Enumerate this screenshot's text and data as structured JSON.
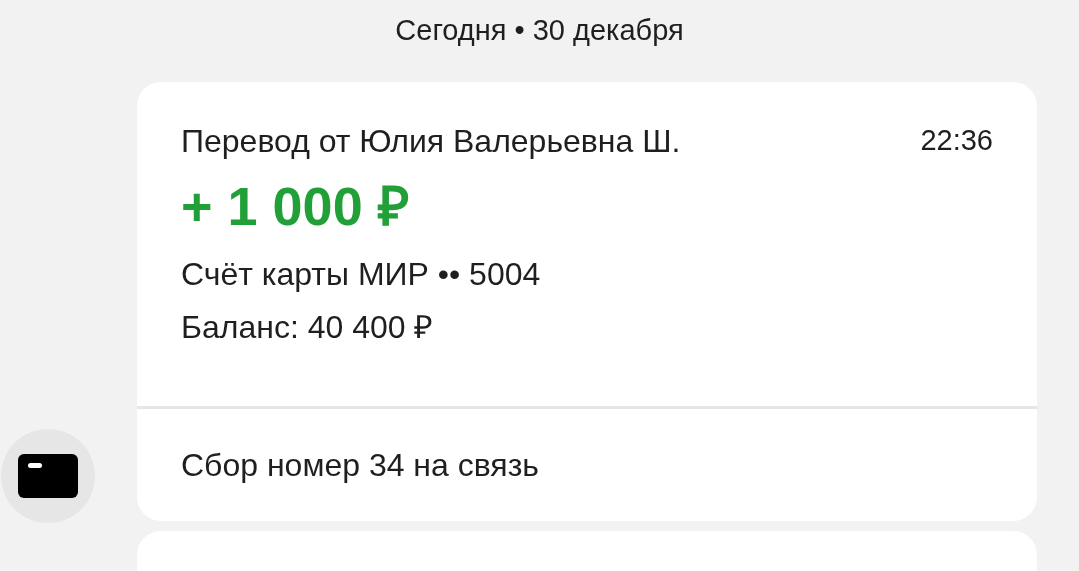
{
  "date_header": "Сегодня • 30 декабря",
  "message": {
    "title": "Перевод от Юлия Валерьевна Ш.",
    "time": "22:36",
    "amount": "+ 1 000 ₽",
    "account": "Счёт карты МИР •• 5004",
    "balance": "Баланс: 40 400 ₽",
    "comment": "Сбор номер 34 на связь"
  }
}
